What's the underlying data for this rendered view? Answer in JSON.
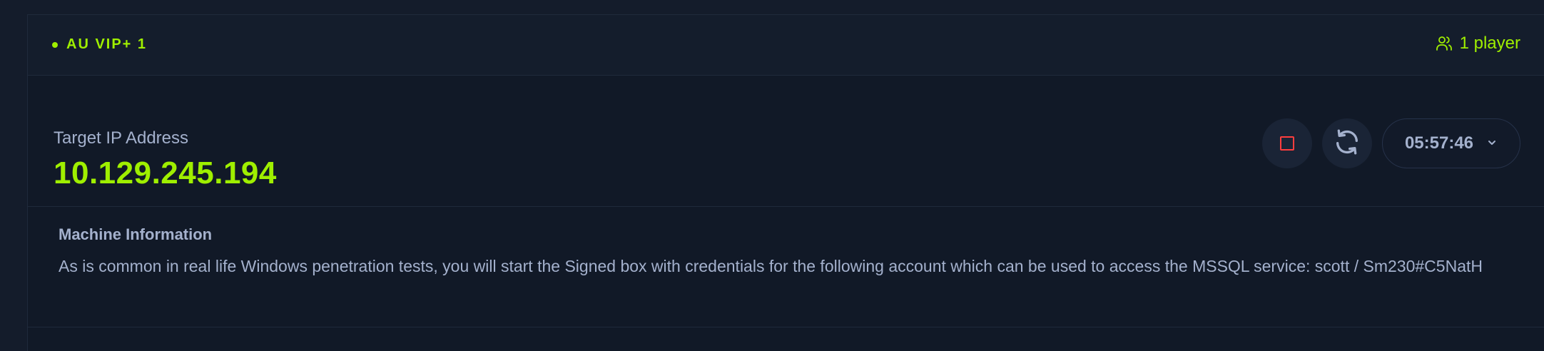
{
  "header": {
    "server_label": "AU VIP+ 1",
    "players_label": "1 player"
  },
  "target": {
    "label": "Target IP Address",
    "ip": "10.129.245.194"
  },
  "controls": {
    "timer": "05:57:46"
  },
  "machine_info": {
    "title": "Machine Information",
    "text": "As is common in real life Windows penetration tests, you will start the Signed box with credentials for the following account which can be used to access the MSSQL service: scott / Sm230#C5NatH"
  },
  "colors": {
    "accent": "#9fef00",
    "stop": "#ff3e3e",
    "text_muted": "#a4b1cd",
    "background": "#111927"
  },
  "icons": {
    "server_status": "status-dot-icon",
    "players": "users-icon",
    "stop": "stop-icon",
    "reset": "refresh-icon",
    "expand": "chevron-down-icon"
  }
}
